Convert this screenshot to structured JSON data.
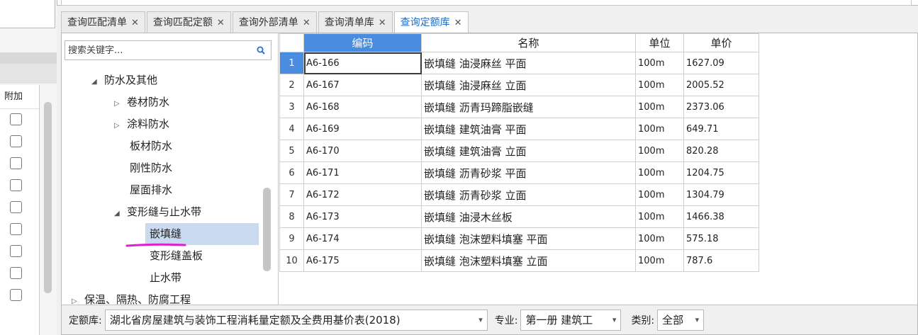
{
  "tabs": [
    {
      "label": "查询匹配清单",
      "close": "✕"
    },
    {
      "label": "查询匹配定额",
      "close": "✕"
    },
    {
      "label": "查询外部清单",
      "close": "✕"
    },
    {
      "label": "查询清单库",
      "close": "✕"
    },
    {
      "label": "查询定额库",
      "close": "✕",
      "active": true
    }
  ],
  "left_panel": {
    "column_header": "附加",
    "checkbox_count": 9
  },
  "search": {
    "placeholder": "搜索关键字..."
  },
  "tree": {
    "items": [
      {
        "label": "防水及其他",
        "toggle": "◢"
      },
      {
        "label": "卷材防水",
        "toggle": "▷"
      },
      {
        "label": "涂料防水",
        "toggle": "▷"
      },
      {
        "label": "板材防水",
        "toggle": ""
      },
      {
        "label": "刚性防水",
        "toggle": ""
      },
      {
        "label": "屋面排水",
        "toggle": ""
      },
      {
        "label": "变形缝与止水带",
        "toggle": "◢"
      },
      {
        "label": "嵌填缝",
        "toggle": "",
        "selected": true
      },
      {
        "label": "变形缝盖板",
        "toggle": ""
      },
      {
        "label": "止水带",
        "toggle": ""
      },
      {
        "label": "保温、隔热、防腐工程",
        "toggle": "▷"
      }
    ]
  },
  "table": {
    "headers": [
      "编码",
      "名称",
      "单位",
      "单价"
    ],
    "rows": [
      {
        "n": "1",
        "code": "A6-166",
        "name": "嵌填缝 油浸麻丝 平面",
        "unit": "100m",
        "price": "1627.09"
      },
      {
        "n": "2",
        "code": "A6-167",
        "name": "嵌填缝 油浸麻丝 立面",
        "unit": "100m",
        "price": "2005.52"
      },
      {
        "n": "3",
        "code": "A6-168",
        "name": "嵌填缝 沥青玛蹄脂嵌缝",
        "unit": "100m",
        "price": "2373.06"
      },
      {
        "n": "4",
        "code": "A6-169",
        "name": "嵌填缝 建筑油膏 平面",
        "unit": "100m",
        "price": "649.71"
      },
      {
        "n": "5",
        "code": "A6-170",
        "name": "嵌填缝 建筑油膏 立面",
        "unit": "100m",
        "price": "820.28"
      },
      {
        "n": "6",
        "code": "A6-171",
        "name": "嵌填缝 沥青砂浆 平面",
        "unit": "100m",
        "price": "1204.75"
      },
      {
        "n": "7",
        "code": "A6-172",
        "name": "嵌填缝 沥青砂浆 立面",
        "unit": "100m",
        "price": "1304.79"
      },
      {
        "n": "8",
        "code": "A6-173",
        "name": "嵌填缝 油浸木丝板",
        "unit": "100m",
        "price": "1466.38"
      },
      {
        "n": "9",
        "code": "A6-174",
        "name": "嵌填缝 泡沫塑料填塞 平面",
        "unit": "100m",
        "price": "575.18"
      },
      {
        "n": "10",
        "code": "A6-175",
        "name": "嵌填缝 泡沫塑料填塞 立面",
        "unit": "100m",
        "price": "787.6"
      }
    ]
  },
  "footer": {
    "library_label": "定额库:",
    "library_value": "湖北省房屋建筑与装饰工程消耗量定额及全费用基价表(2018)",
    "major_label": "专业:",
    "major_value": "第一册 建筑工",
    "category_label": "类别:",
    "category_value": "全部",
    "arrow": "▾"
  },
  "colors": {
    "accent": "#4a8ce0",
    "selected_row": "#c8d9f0",
    "active_tab_text": "#1a6dc9",
    "annotation": "#e020c8"
  }
}
